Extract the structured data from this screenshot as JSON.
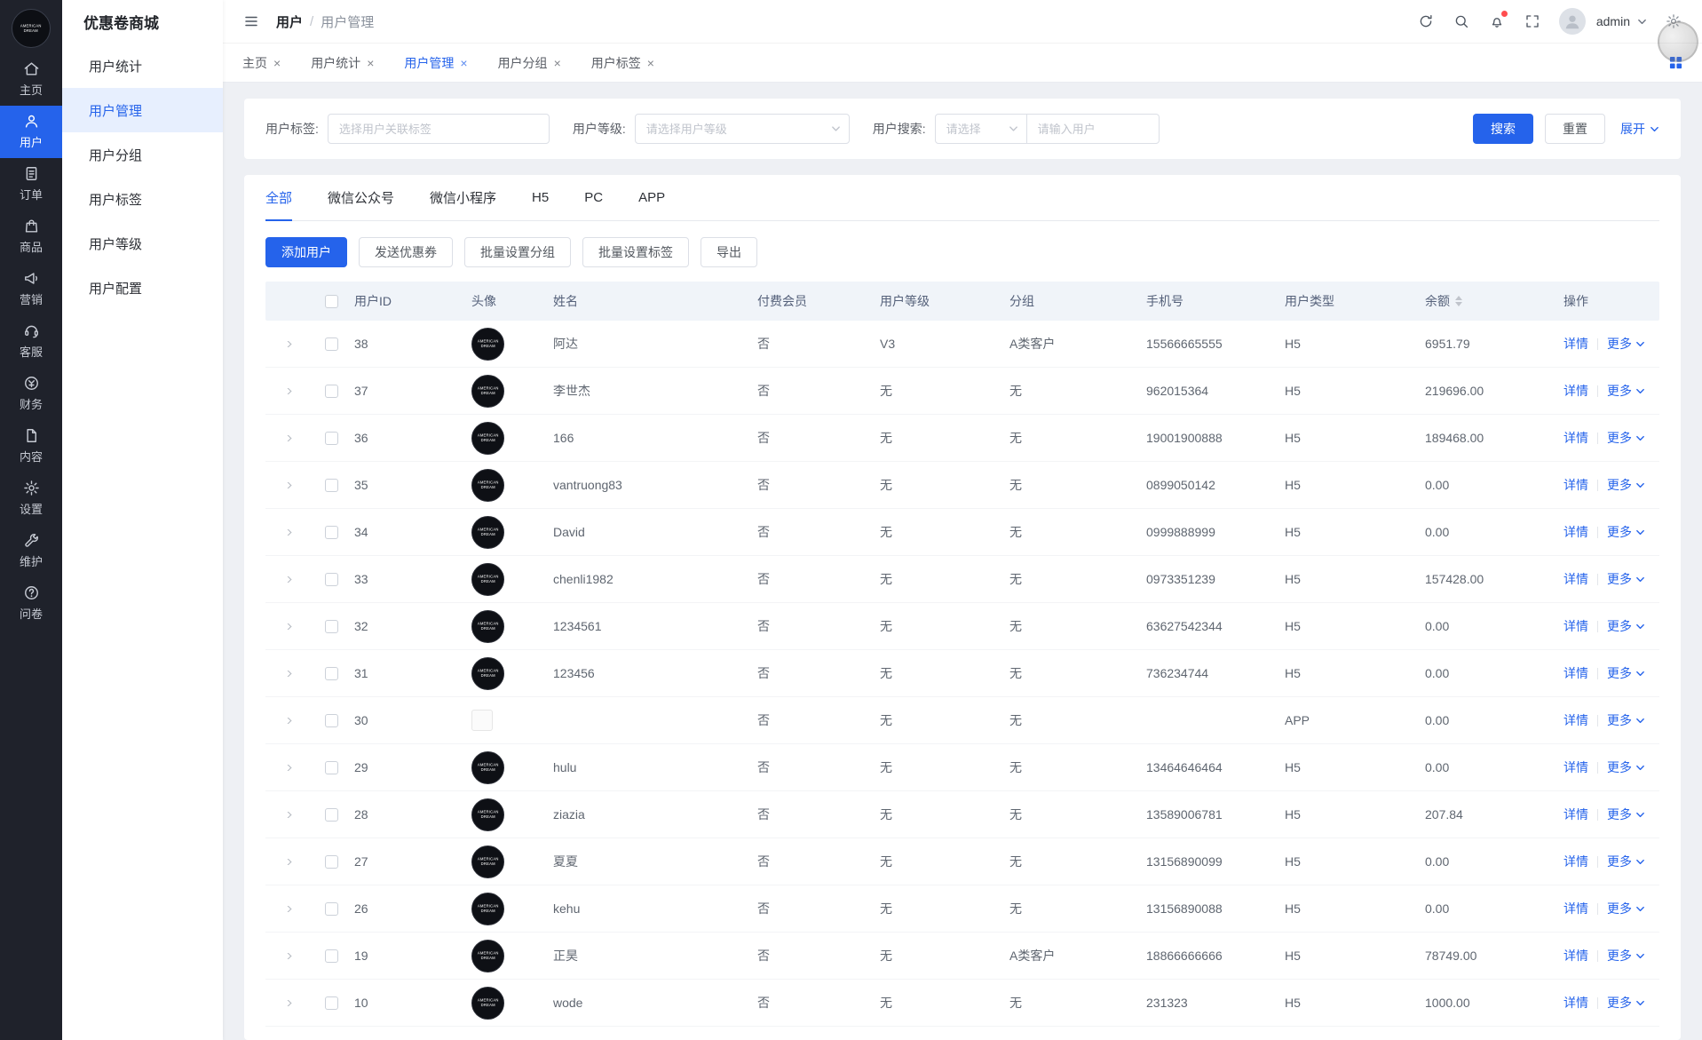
{
  "rail": {
    "logo": {
      "line1": "AMERICAN",
      "line2": "DREAM"
    },
    "items": [
      {
        "label": "主页",
        "icon": "home-icon",
        "active": false
      },
      {
        "label": "用户",
        "icon": "user-icon",
        "active": true
      },
      {
        "label": "订单",
        "icon": "order-icon",
        "active": false
      },
      {
        "label": "商品",
        "icon": "goods-icon",
        "active": false
      },
      {
        "label": "营销",
        "icon": "marketing-icon",
        "active": false
      },
      {
        "label": "客服",
        "icon": "service-icon",
        "active": false
      },
      {
        "label": "财务",
        "icon": "finance-icon",
        "active": false
      },
      {
        "label": "内容",
        "icon": "content-icon",
        "active": false
      },
      {
        "label": "设置",
        "icon": "settings-icon",
        "active": false
      },
      {
        "label": "维护",
        "icon": "maintain-icon",
        "active": false
      },
      {
        "label": "问卷",
        "icon": "survey-icon",
        "active": false
      }
    ]
  },
  "submenu": {
    "title": "优惠卷商城",
    "items": [
      {
        "label": "用户统计",
        "active": false
      },
      {
        "label": "用户管理",
        "active": true
      },
      {
        "label": "用户分组",
        "active": false
      },
      {
        "label": "用户标签",
        "active": false
      },
      {
        "label": "用户等级",
        "active": false
      },
      {
        "label": "用户配置",
        "active": false
      }
    ]
  },
  "topbar": {
    "breadcrumb": {
      "section": "用户",
      "separator": "/",
      "page": "用户管理"
    },
    "username": "admin"
  },
  "tabbar": {
    "close_glyph": "×",
    "tabs": [
      {
        "label": "主页",
        "active": false
      },
      {
        "label": "用户统计",
        "active": false
      },
      {
        "label": "用户管理",
        "active": true
      },
      {
        "label": "用户分组",
        "active": false
      },
      {
        "label": "用户标签",
        "active": false
      }
    ]
  },
  "filters": {
    "tag_label": "用户标签:",
    "tag_placeholder": "选择用户关联标签",
    "level_label": "用户等级:",
    "level_placeholder": "请选择用户等级",
    "search_label": "用户搜索:",
    "search_select_placeholder": "请选择",
    "search_input_placeholder": "请输入用户",
    "search_button": "搜索",
    "reset_button": "重置",
    "expand_button": "展开"
  },
  "panel": {
    "type_tabs": [
      {
        "label": "全部",
        "active": true
      },
      {
        "label": "微信公众号",
        "active": false
      },
      {
        "label": "微信小程序",
        "active": false
      },
      {
        "label": "H5",
        "active": false
      },
      {
        "label": "PC",
        "active": false
      },
      {
        "label": "APP",
        "active": false
      }
    ],
    "actions": [
      {
        "label": "添加用户",
        "primary": true
      },
      {
        "label": "发送优惠券",
        "primary": false
      },
      {
        "label": "批量设置分组",
        "primary": false
      },
      {
        "label": "批量设置标签",
        "primary": false
      },
      {
        "label": "导出",
        "primary": false
      }
    ]
  },
  "table": {
    "columns": [
      "用户ID",
      "头像",
      "姓名",
      "付费会员",
      "用户等级",
      "分组",
      "手机号",
      "用户类型",
      "余额",
      "操作"
    ],
    "detail_label": "详情",
    "more_label": "更多",
    "avatar_text": {
      "line1": "AMERICAN",
      "line2": "DREAM"
    },
    "rows": [
      {
        "id": "38",
        "name": "阿达",
        "paid": "否",
        "level": "V3",
        "group": "A类客户",
        "phone": "15566665555",
        "type": "H5",
        "balance": "6951.79",
        "avatar": "logo"
      },
      {
        "id": "37",
        "name": "李世杰",
        "paid": "否",
        "level": "无",
        "group": "无",
        "phone": "962015364",
        "type": "H5",
        "balance": "219696.00",
        "avatar": "logo"
      },
      {
        "id": "36",
        "name": "166",
        "paid": "否",
        "level": "无",
        "group": "无",
        "phone": "19001900888",
        "type": "H5",
        "balance": "189468.00",
        "avatar": "logo"
      },
      {
        "id": "35",
        "name": "vantruong83",
        "paid": "否",
        "level": "无",
        "group": "无",
        "phone": "0899050142",
        "type": "H5",
        "balance": "0.00",
        "avatar": "logo"
      },
      {
        "id": "34",
        "name": "David",
        "paid": "否",
        "level": "无",
        "group": "无",
        "phone": "0999888999",
        "type": "H5",
        "balance": "0.00",
        "avatar": "logo"
      },
      {
        "id": "33",
        "name": "chenli1982",
        "paid": "否",
        "level": "无",
        "group": "无",
        "phone": "0973351239",
        "type": "H5",
        "balance": "157428.00",
        "avatar": "logo"
      },
      {
        "id": "32",
        "name": "1234561",
        "paid": "否",
        "level": "无",
        "group": "无",
        "phone": "63627542344",
        "type": "H5",
        "balance": "0.00",
        "avatar": "logo"
      },
      {
        "id": "31",
        "name": "123456",
        "paid": "否",
        "level": "无",
        "group": "无",
        "phone": "736234744",
        "type": "H5",
        "balance": "0.00",
        "avatar": "logo"
      },
      {
        "id": "30",
        "name": "",
        "paid": "否",
        "level": "无",
        "group": "无",
        "phone": "",
        "type": "APP",
        "balance": "0.00",
        "avatar": "broken"
      },
      {
        "id": "29",
        "name": "hulu",
        "paid": "否",
        "level": "无",
        "group": "无",
        "phone": "13464646464",
        "type": "H5",
        "balance": "0.00",
        "avatar": "logo"
      },
      {
        "id": "28",
        "name": "ziazia",
        "paid": "否",
        "level": "无",
        "group": "无",
        "phone": "13589006781",
        "type": "H5",
        "balance": "207.84",
        "avatar": "logo"
      },
      {
        "id": "27",
        "name": "夏夏",
        "paid": "否",
        "level": "无",
        "group": "无",
        "phone": "13156890099",
        "type": "H5",
        "balance": "0.00",
        "avatar": "logo"
      },
      {
        "id": "26",
        "name": "kehu",
        "paid": "否",
        "level": "无",
        "group": "无",
        "phone": "13156890088",
        "type": "H5",
        "balance": "0.00",
        "avatar": "logo"
      },
      {
        "id": "19",
        "name": "正昊",
        "paid": "否",
        "level": "无",
        "group": "A类客户",
        "phone": "18866666666",
        "type": "H5",
        "balance": "78749.00",
        "avatar": "logo"
      },
      {
        "id": "10",
        "name": "wode",
        "paid": "否",
        "level": "无",
        "group": "无",
        "phone": "231323",
        "type": "H5",
        "balance": "1000.00",
        "avatar": "logo"
      }
    ]
  },
  "colors": {
    "accent": "#2563eb",
    "sidebar_bg": "#1f222b",
    "table_header_bg": "#f0f4f9"
  }
}
